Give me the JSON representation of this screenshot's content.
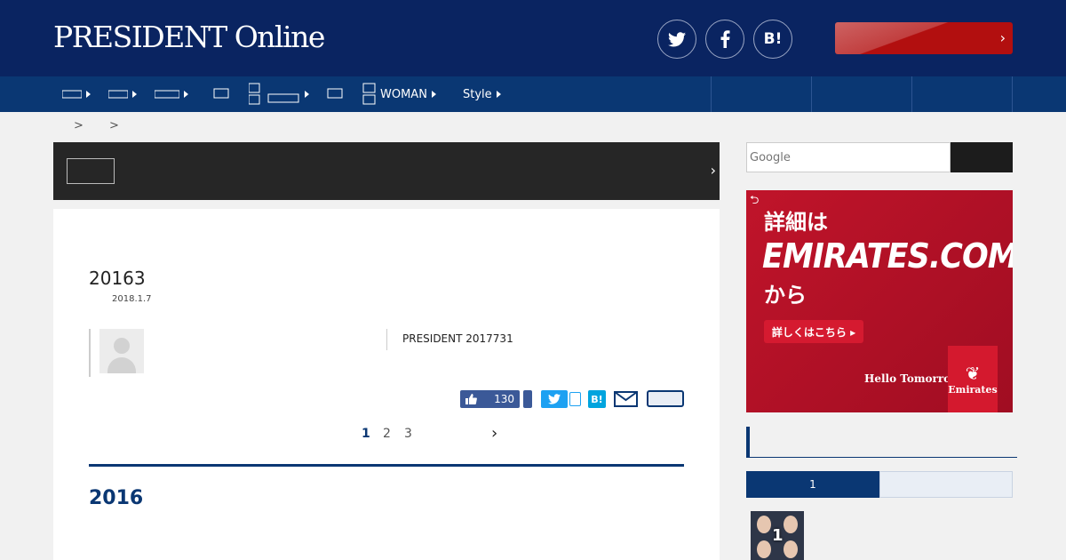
{
  "header": {
    "logo": "PRESIDENT Online",
    "social": [
      {
        "name": "twitter-icon"
      },
      {
        "name": "facebook-icon"
      },
      {
        "name": "hatena-bookmark-icon",
        "label": "B!"
      }
    ],
    "cta_chevron": "›"
  },
  "nav": {
    "items": [
      {
        "label": "",
        "caret": true
      },
      {
        "label": "",
        "caret": true
      },
      {
        "label": "",
        "caret": true
      },
      {
        "label": "",
        "caret": false
      },
      {
        "label": "",
        "caret": true
      },
      {
        "label": "",
        "caret": false
      },
      {
        "label": "WOMAN",
        "caret": true
      },
      {
        "label": "Style",
        "caret": true
      }
    ]
  },
  "breadcrumb": {
    "sep1": ">",
    "sep2": ">"
  },
  "darkbar": {
    "chevron": "›"
  },
  "article": {
    "title": "20163",
    "date": "2018.1.7",
    "source": "PRESIDENT 2017731",
    "share": {
      "fb_count": "130",
      "hatena": "B!"
    },
    "pager": {
      "pages": [
        "1",
        "2",
        "3"
      ],
      "active": "1",
      "next": "›"
    },
    "section_heading": "2016"
  },
  "sidebar": {
    "search": {
      "placeholder": "Google"
    },
    "ad": {
      "undo": "⮌",
      "line1": "詳細は",
      "line2": "EMIRATES.COM",
      "line3": "から",
      "button": "詳しくはこちら ▸",
      "tagline": "Hello Tomorrow",
      "logo_word": "Emirates"
    },
    "ranking": {
      "tab_active": "1",
      "tab_inactive": "",
      "first_rank": "1"
    }
  },
  "colors": {
    "header_bg": "#0a2461",
    "nav_bg": "#0a3773",
    "accent": "#0a3773",
    "ad_red": "#c0142a",
    "cta_red": "#b20f0f"
  }
}
